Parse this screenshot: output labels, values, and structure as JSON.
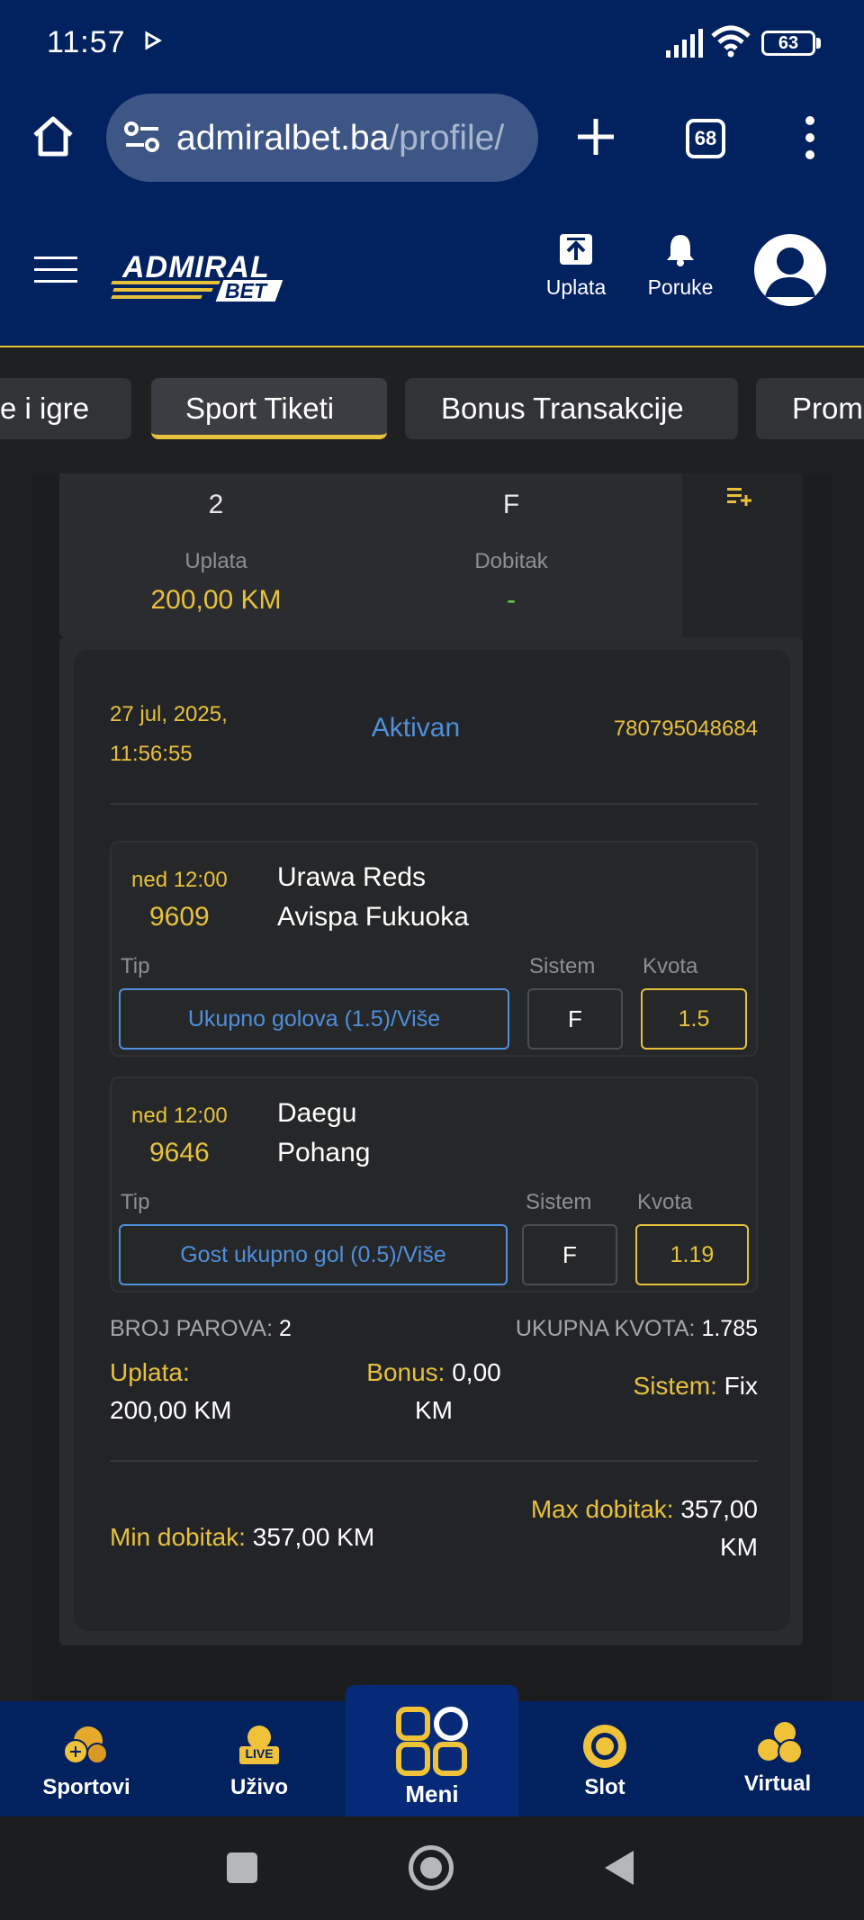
{
  "status_bar": {
    "time": "11:57",
    "battery": "63"
  },
  "browser": {
    "url_domain": "admiralbet.ba",
    "url_path": "/profile/",
    "tab_count": "68"
  },
  "header": {
    "logo_top": "ADMIRAL",
    "logo_bottom": "BET",
    "deposit_label": "Uplata",
    "messages_label": "Poruke"
  },
  "tabs": [
    {
      "label": "e i igre"
    },
    {
      "label": "Sport Tiketi"
    },
    {
      "label": "Bonus Transakcije"
    },
    {
      "label": "Prom"
    }
  ],
  "prev_ticket": {
    "count_value": "2",
    "system_value": "F",
    "stake_label": "Uplata",
    "stake_value": "200,00 KM",
    "win_label": "Dobitak",
    "win_value": "-"
  },
  "ticket": {
    "date_line1": "27 jul, 2025,",
    "date_line2": "11:56:55",
    "status": "Aktivan",
    "ticket_id": "780795048684",
    "matches": [
      {
        "time": "ned 12:00",
        "code": "9609",
        "home": "Urawa Reds",
        "away": "Avispa Fukuoka",
        "tip_label": "Tip",
        "sys_label": "Sistem",
        "odd_label": "Kvota",
        "tip": "Ukupno golova (1.5)/Više",
        "system": "F",
        "odd": "1.5"
      },
      {
        "time": "ned 12:00",
        "code": "9646",
        "home": "Daegu",
        "away": "Pohang",
        "tip_label": "Tip",
        "sys_label": "Sistem",
        "odd_label": "Kvota",
        "tip": "Gost ukupno gol (0.5)/Više",
        "system": "F",
        "odd": "1.19"
      }
    ],
    "pairs_label": "BROJ PAROVA:",
    "pairs_value": "2",
    "total_odd_label": "UKUPNA KVOTA:",
    "total_odd_value": "1.785",
    "stake_label": "Uplata:",
    "stake_value": "200,00 KM",
    "bonus_label": "Bonus:",
    "bonus_value_1": "0,00",
    "bonus_value_2": "KM",
    "system_label": "Sistem:",
    "system_value": "Fix",
    "min_win_label": "Min dobitak:",
    "min_win_value": "357,00 KM",
    "max_win_label": "Max dobitak:",
    "max_win_value_1": "357,00",
    "max_win_value_2": "KM"
  },
  "bottom_nav": [
    {
      "label": "Sportovi"
    },
    {
      "label": "Uživo",
      "badge": "LIVE"
    },
    {
      "label": "Meni"
    },
    {
      "label": "Slot"
    },
    {
      "label": "Virtual"
    }
  ],
  "colors": {
    "navy": "#02215f",
    "accent_yellow": "#e7c13c",
    "link_blue": "#4f8fdb",
    "background": "#1f2022"
  }
}
